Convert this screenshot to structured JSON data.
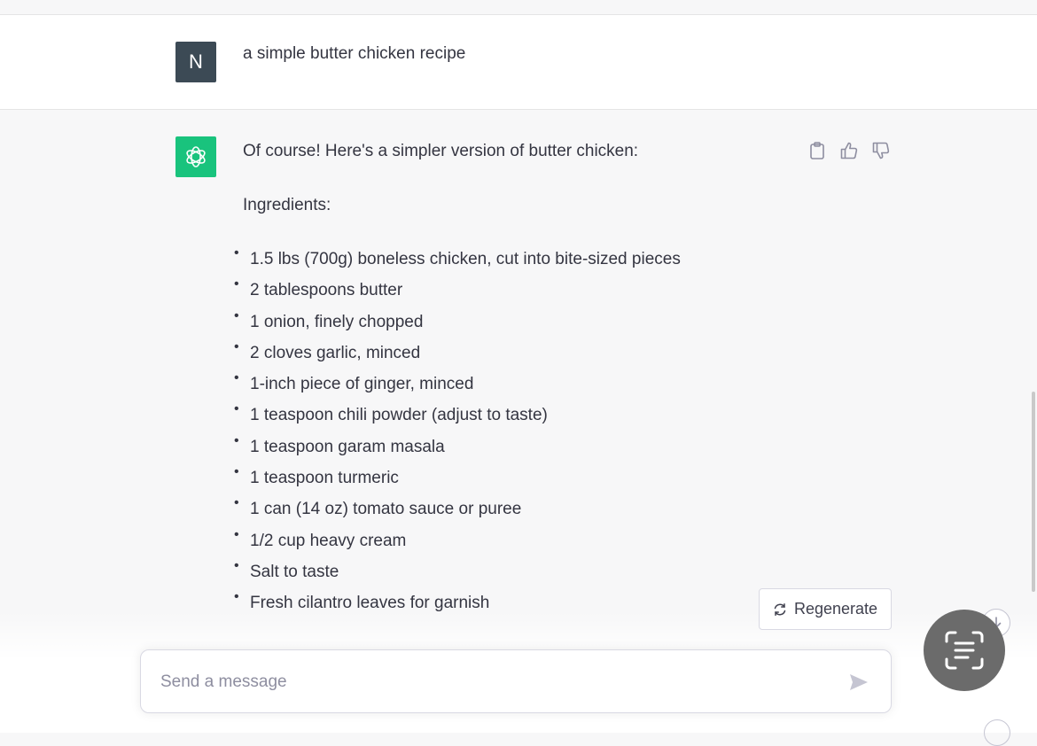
{
  "user_message": {
    "avatar_initial": "N",
    "text": "a simple butter chicken recipe"
  },
  "assistant_message": {
    "intro": "Of course! Here's a simpler version of butter chicken:",
    "heading": "Ingredients:",
    "bullet": "•",
    "ingredients": [
      "1.5 lbs (700g) boneless chicken, cut into bite-sized pieces",
      "2 tablespoons butter",
      "1 onion, finely chopped",
      "2 cloves garlic, minced",
      "1-inch piece of ginger, minced",
      "1 teaspoon chili powder (adjust to taste)",
      "1 teaspoon garam masala",
      "1 teaspoon turmeric",
      "1 can (14 oz) tomato sauce or puree",
      "1/2 cup heavy cream",
      "Salt to taste",
      "Fresh cilantro leaves for garnish"
    ],
    "actions": [
      "clipboard-icon",
      "thumbs-up-icon",
      "thumbs-down-icon"
    ]
  },
  "regenerate": {
    "label": "Regenerate",
    "icon": "refresh-icon"
  },
  "composer": {
    "placeholder": "Send a message",
    "value": "",
    "send_icon": "send-icon"
  },
  "colors": {
    "bot_avatar": "#19c37d",
    "user_avatar": "#3c4a55",
    "assistant_bg": "#f7f7f8",
    "user_bg": "#ffffff"
  }
}
